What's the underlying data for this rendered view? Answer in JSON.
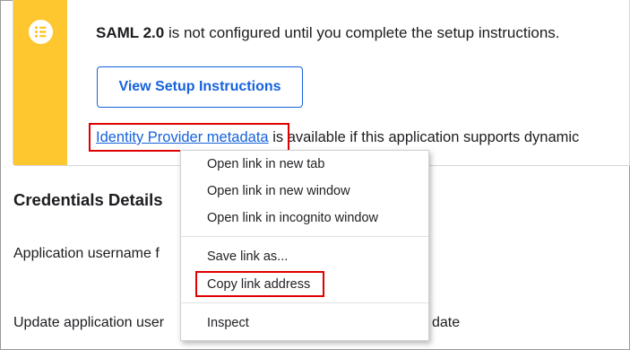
{
  "notice": {
    "icon": "list-icon",
    "accent_color": "#fec72f",
    "message_bold": "SAML 2.0",
    "message_rest": " is not configured until you complete the setup instructions.",
    "setup_button_label": "View Setup Instructions",
    "metadata_link_text": "Identity Provider metadata",
    "metadata_rest": " is available if this application supports dynamic"
  },
  "credentials": {
    "title": "Credentials Details",
    "username_label": "Application username f",
    "update_label": "Update application user",
    "update_label_tail": "date"
  },
  "context_menu": {
    "items": [
      "Open link in new tab",
      "Open link in new window",
      "Open link in incognito window",
      "Save link as...",
      "Copy link address",
      "Inspect"
    ]
  },
  "colors": {
    "link": "#1662dd",
    "highlight": "#e00000"
  }
}
